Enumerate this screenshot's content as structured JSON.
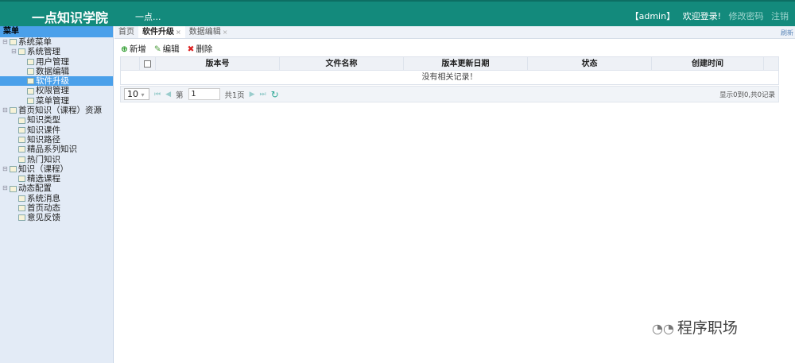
{
  "header": {
    "logo": "一点知识学院",
    "subtitle": "一点...",
    "user": "【admin】",
    "welcome": "欢迎登录!",
    "change_password": "修改密码",
    "logout": "注销"
  },
  "sidebar": {
    "title": "菜单",
    "nodes": [
      {
        "label": "系统菜单",
        "level": 0,
        "expander": true
      },
      {
        "label": "系统管理",
        "level": 1,
        "expander": true
      },
      {
        "label": "用户管理",
        "level": 2
      },
      {
        "label": "数据编辑",
        "level": 2
      },
      {
        "label": "软件升级",
        "level": 2,
        "selected": true
      },
      {
        "label": "权限管理",
        "level": 2
      },
      {
        "label": "菜单管理",
        "level": 2
      },
      {
        "label": "首页知识（课程）资源",
        "level": 0,
        "expander": true
      },
      {
        "label": "知识类型",
        "level": 1
      },
      {
        "label": "知识课件",
        "level": 1
      },
      {
        "label": "知识路径",
        "level": 1
      },
      {
        "label": "精品系列知识",
        "level": 1
      },
      {
        "label": "热门知识",
        "level": 1
      },
      {
        "label": "知识（课程）",
        "level": 0,
        "expander": true
      },
      {
        "label": "精选课程",
        "level": 1
      },
      {
        "label": "动态配置",
        "level": 0,
        "expander": true
      },
      {
        "label": "系统消息",
        "level": 1
      },
      {
        "label": "首页动态",
        "level": 1
      },
      {
        "label": "意见反馈",
        "level": 1
      }
    ]
  },
  "tabs": [
    {
      "label": "首页"
    },
    {
      "label": "软件升级",
      "active": true,
      "closable": true
    },
    {
      "label": "数据编辑",
      "closable": true
    }
  ],
  "refresh": "刷新",
  "toolbar": {
    "add": "新增",
    "edit": "编辑",
    "delete": "删除"
  },
  "grid": {
    "columns": [
      "版本号",
      "文件名称",
      "版本更新日期",
      "状态",
      "创建时间"
    ],
    "empty": "没有相关记录！"
  },
  "pager": {
    "page_size": "10",
    "page_prefix": "第",
    "page": "1",
    "total_pages": "共1页",
    "info": "显示0到0,共0记录"
  },
  "watermark": "程序职场"
}
